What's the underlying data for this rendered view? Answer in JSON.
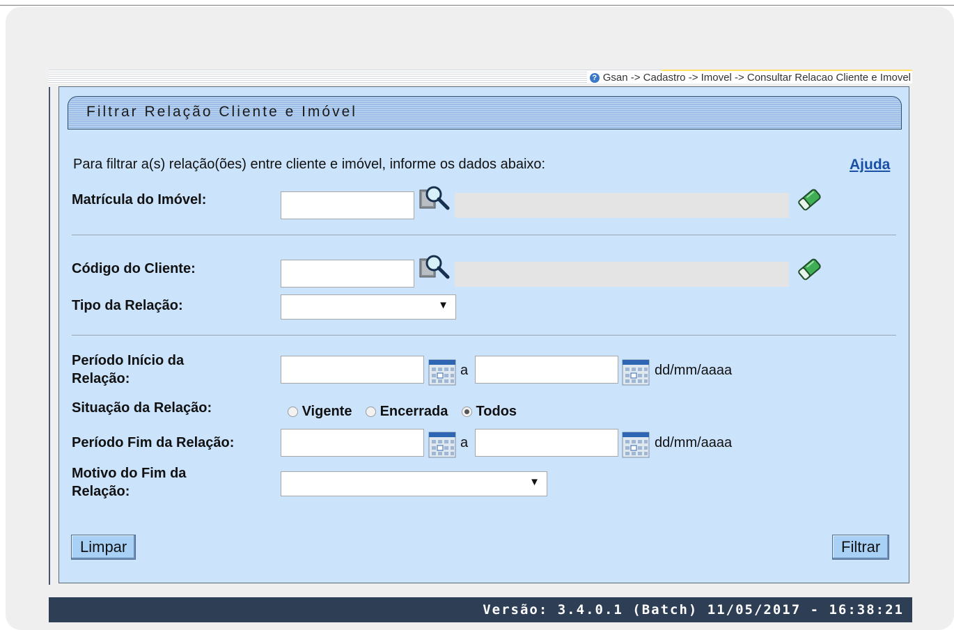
{
  "breadcrumb": "Gsan -> Cadastro -> Imovel -> Consultar Relacao Cliente e Imovel",
  "title": "Filtrar Relação Cliente e Imóvel",
  "intro": "Para filtrar a(s) relação(ões) entre cliente e imóvel, informe os dados abaixo:",
  "help_link": "Ajuda",
  "fields": {
    "matricula_label": "Matrícula do Imóvel:",
    "matricula_value": "",
    "codigo_cliente_label": "Código do Cliente:",
    "codigo_cliente_value": "",
    "tipo_relacao_label": "Tipo da Relação:",
    "tipo_relacao_selected": "",
    "periodo_inicio_label": "Período Início da Relação:",
    "periodo_inicio_de": "",
    "periodo_inicio_ate": "",
    "connector": "a",
    "date_format": "dd/mm/aaaa",
    "situacao_label": "Situação da Relação:",
    "situacao_options": [
      "Vigente",
      "Encerrada",
      "Todos"
    ],
    "situacao_selected": "Todos",
    "periodo_fim_label": "Período Fim da Relação:",
    "periodo_fim_de": "",
    "periodo_fim_ate": "",
    "motivo_fim_label": "Motivo do Fim da Relação:",
    "motivo_fim_selected": ""
  },
  "buttons": {
    "limpar": "Limpar",
    "filtrar": "Filtrar"
  },
  "icons": {
    "search": "magnifier-search-icon",
    "clear": "eraser-icon",
    "calendar": "calendar-icon",
    "help": "help-circle-icon"
  },
  "footer": "Versão: 3.4.0.1 (Batch) 11/05/2017 - 16:38:21"
}
